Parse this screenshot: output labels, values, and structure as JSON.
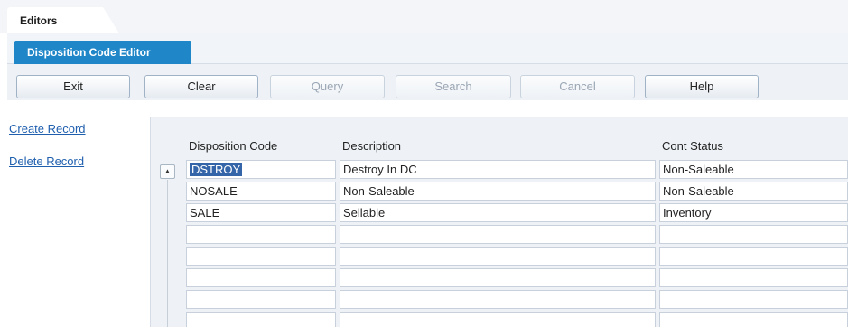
{
  "outer_tab": {
    "label": "Editors"
  },
  "inner_tab": {
    "label": "Disposition Code Editor"
  },
  "toolbar": {
    "exit": "Exit",
    "clear": "Clear",
    "query": "Query",
    "search": "Search",
    "cancel": "Cancel",
    "help": "Help"
  },
  "links": {
    "create": "Create Record",
    "delete": "Delete Record"
  },
  "grid": {
    "columns": [
      "Disposition Code",
      "Description",
      "Cont Status"
    ],
    "rows": [
      [
        "DSTROY",
        "Destroy In DC",
        "Non-Saleable"
      ],
      [
        "NOSALE",
        "Non-Saleable",
        "Non-Saleable"
      ],
      [
        "SALE",
        "Sellable",
        "Inventory"
      ],
      [
        "",
        "",
        ""
      ],
      [
        "",
        "",
        ""
      ],
      [
        "",
        "",
        ""
      ],
      [
        "",
        "",
        ""
      ],
      [
        "",
        "",
        ""
      ]
    ]
  }
}
